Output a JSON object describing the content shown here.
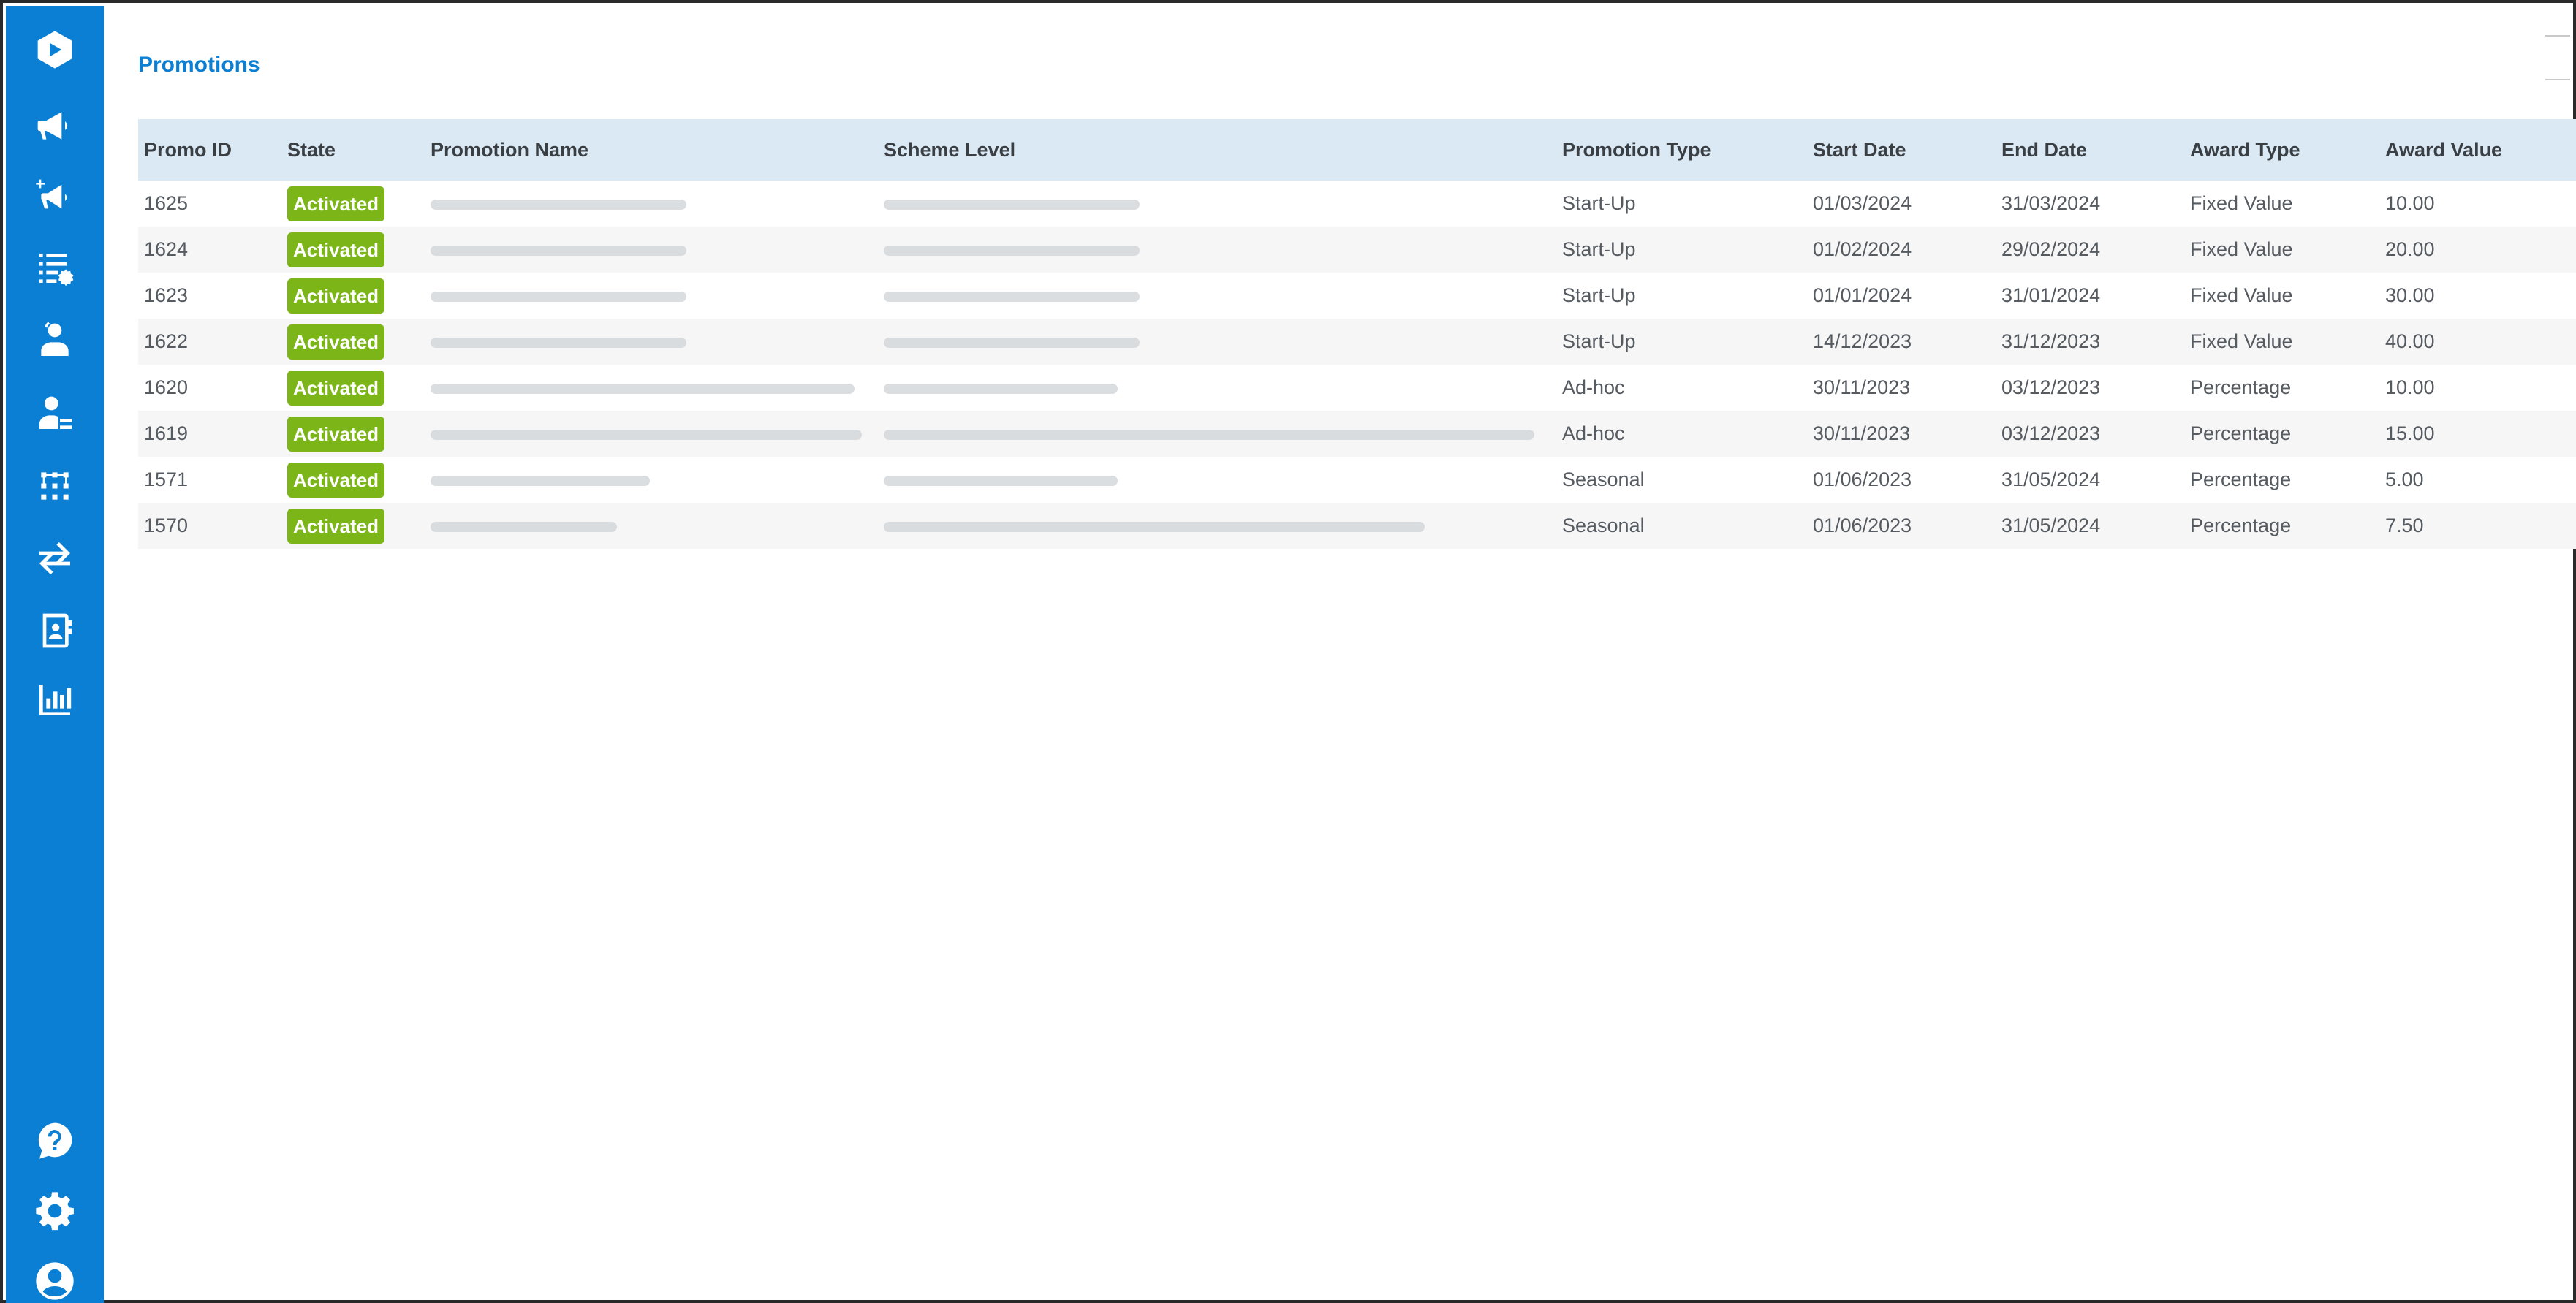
{
  "page": {
    "title": "Promotions"
  },
  "sidebar": {
    "items": [
      {
        "icon": "logo-icon"
      },
      {
        "icon": "megaphone-icon"
      },
      {
        "icon": "megaphone-add-icon"
      },
      {
        "icon": "list-settings-icon"
      },
      {
        "icon": "user-settings-icon"
      },
      {
        "icon": "user-checklist-icon"
      },
      {
        "icon": "grid-icon"
      },
      {
        "icon": "transfer-arrows-icon"
      },
      {
        "icon": "contact-card-icon"
      },
      {
        "icon": "bar-chart-icon"
      },
      {
        "icon": "help-icon"
      },
      {
        "icon": "gear-icon"
      },
      {
        "icon": "account-icon"
      }
    ]
  },
  "table": {
    "columns": [
      "Promo ID",
      "State",
      "Promotion Name",
      "Scheme Level",
      "Promotion Type",
      "Start Date",
      "End Date",
      "Award Type",
      "Award Value"
    ],
    "rows": [
      {
        "id": "1625",
        "state": "Activated",
        "type": "Start-Up",
        "start": "01/03/2024",
        "end": "31/03/2024",
        "award_type": "Fixed Value",
        "award_value": "10.00"
      },
      {
        "id": "1624",
        "state": "Activated",
        "type": "Start-Up",
        "start": "01/02/2024",
        "end": "29/02/2024",
        "award_type": "Fixed Value",
        "award_value": "20.00"
      },
      {
        "id": "1623",
        "state": "Activated",
        "type": "Start-Up",
        "start": "01/01/2024",
        "end": "31/01/2024",
        "award_type": "Fixed Value",
        "award_value": "30.00"
      },
      {
        "id": "1622",
        "state": "Activated",
        "type": "Start-Up",
        "start": "14/12/2023",
        "end": "31/12/2023",
        "award_type": "Fixed Value",
        "award_value": "40.00"
      },
      {
        "id": "1620",
        "state": "Activated",
        "type": "Ad-hoc",
        "start": "30/11/2023",
        "end": "03/12/2023",
        "award_type": "Percentage",
        "award_value": "10.00"
      },
      {
        "id": "1619",
        "state": "Activated",
        "type": "Ad-hoc",
        "start": "30/11/2023",
        "end": "03/12/2023",
        "award_type": "Percentage",
        "award_value": "15.00"
      },
      {
        "id": "1571",
        "state": "Activated",
        "type": "Seasonal",
        "start": "01/06/2023",
        "end": "31/05/2024",
        "award_type": "Percentage",
        "award_value": "5.00"
      },
      {
        "id": "1570",
        "state": "Activated",
        "type": "Seasonal",
        "start": "01/06/2023",
        "end": "31/05/2024",
        "award_type": "Percentage",
        "award_value": "7.50"
      }
    ]
  },
  "colors": {
    "sidebar": "#0b7fd3",
    "accent": "#0b7fd3",
    "badge": "#7cb518",
    "header_row": "#dbe9f5"
  }
}
